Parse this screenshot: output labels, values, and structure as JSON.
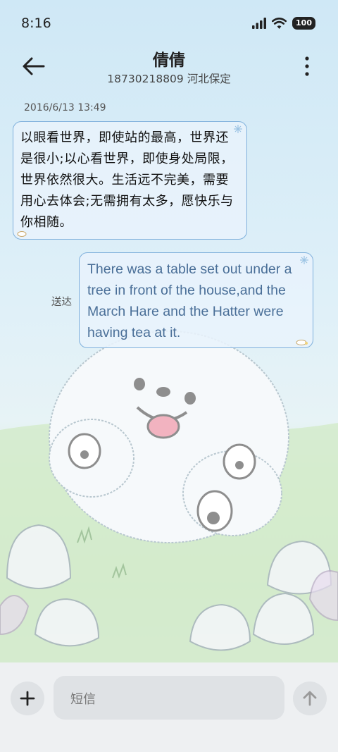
{
  "status_bar": {
    "time": "8:16",
    "battery": "100",
    "icons": [
      "signal-icon",
      "wifi-icon",
      "battery-icon"
    ]
  },
  "header": {
    "contact_name": "倩倩",
    "contact_subtitle": "18730218809 河北保定",
    "icons": [
      "back-arrow-icon",
      "more-vertical-icon"
    ]
  },
  "conversation": {
    "timestamp": "2016/6/13 13:49",
    "incoming_message": "以眼看世界，即使站的最高，世界还是很小;以心看世界，即使身处局限，世界依然很大。生活远不完美，需要用心去体会;无需拥有太多，愿快乐与你相随。",
    "outgoing_message": "There was a table set out under a tree in front of the house,and the March Hare and the Hatter were having tea at it.",
    "delivered_status": "送达"
  },
  "composer": {
    "placeholder": "短信",
    "icons": [
      "plus-icon",
      "send-arrow-icon"
    ]
  },
  "colors": {
    "bubble_border": "#7fb0dc",
    "bubble_fill": "#e8f3fc",
    "outgoing_text": "#4a6f98",
    "composer_bg": "#eef0f2"
  }
}
